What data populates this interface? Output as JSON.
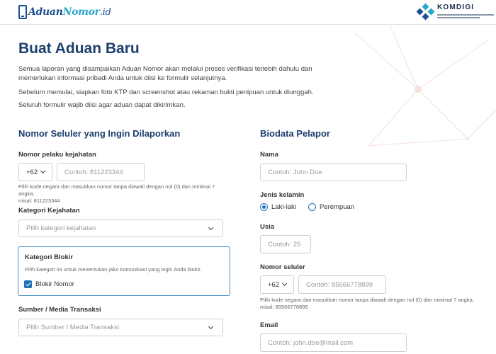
{
  "header": {
    "logo": {
      "aduan": "Aduan",
      "nomor": "Nomor",
      "domain": ".id"
    },
    "brand": {
      "name": "KOMDIGI"
    }
  },
  "page": {
    "title": "Buat Aduan Baru",
    "intro": [
      "Semua laporan yang disampaikan Aduan Nomor akan melalui proses verifikasi terlebih dahulu dan memerlukan informasi pribadi Anda untuk diisi ke formulir selanjutnya.",
      "Sebelum memulai, siapkan foto KTP dan screenshot atau rekaman bukti penipuan untuk diunggah.",
      "Seluruh formulir wajib diisi agar aduan dapat dikirimkan."
    ]
  },
  "left": {
    "section_title": "Nomor Seluler yang Ingin Dilaporkan",
    "perpetrator": {
      "label": "Nomor pelaku kejahatan",
      "country_code": "+62",
      "placeholder": "Contoh: 811223344",
      "hint_line1": "Pilih kode negara dan masukkan nomor tanpa diawali dengan nol (0) dan minimal 7 angka,",
      "hint_line2": "misal: 811223344"
    },
    "crime_category": {
      "label": "Kategori Kejahatan",
      "placeholder": "Pilih kategori kejahatan"
    },
    "block_category": {
      "label": "Kategori Blokir",
      "hint": "Pilih kategori ini untuk menentukan jalur komunikasi yang ingin Anda blokir.",
      "option_label": "Blokir Nomor",
      "checked": true
    },
    "transaction_media": {
      "label": "Sumber / Media Transaksi",
      "placeholder": "Pilih Sumber / Media Transaksi"
    }
  },
  "right": {
    "section_title": "Biodata Pelapor",
    "name": {
      "label": "Nama",
      "placeholder": "Contoh: John Doe"
    },
    "gender": {
      "label": "Jenis kelamin",
      "options": [
        "Laki-laki",
        "Perempuan"
      ],
      "selected": "Laki-laki"
    },
    "age": {
      "label": "Usia",
      "placeholder": "Contoh: 25"
    },
    "phone": {
      "label": "Nomor seluler",
      "country_code": "+62",
      "placeholder": "Contoh: 85566778899",
      "hint_line1": "Pilih kode negara dan masukkan nomor tanpa diawali dengan nol (0) dan minimal 7 angka,",
      "hint_line2": "misal: 85566778899"
    },
    "email": {
      "label": "Email",
      "placeholder": "Contoh: john.doe@mail.com"
    }
  },
  "colors": {
    "title": "#1d3f6e",
    "accent": "#1d6fb8",
    "card_border": "#4a90c2",
    "input_border": "#cfcfcf"
  },
  "icons": [
    "phone-logo-icon",
    "komdigi-logo-icon",
    "chevron-down-icon",
    "check-icon",
    "radio-icon"
  ]
}
